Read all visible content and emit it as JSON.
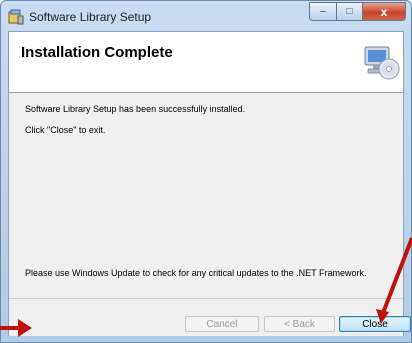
{
  "window": {
    "title": "Software Library Setup",
    "caption_buttons": {
      "minimize": "–",
      "maximize": "□",
      "close": "x"
    }
  },
  "header": {
    "title": "Installation Complete"
  },
  "body": {
    "message1": "Software Library Setup has been successfully installed.",
    "message2": "Click \"Close\" to exit.",
    "message3": "Please use Windows Update to check for any critical updates to the .NET Framework."
  },
  "footer": {
    "cancel_label": "Cancel",
    "back_label": "< Back",
    "close_label": "Close"
  },
  "colors": {
    "annotation_arrow": "#c0120c"
  },
  "icons": [
    "installer-app-icon",
    "computer-cd-icon",
    "arrow-annotation-icon"
  ]
}
